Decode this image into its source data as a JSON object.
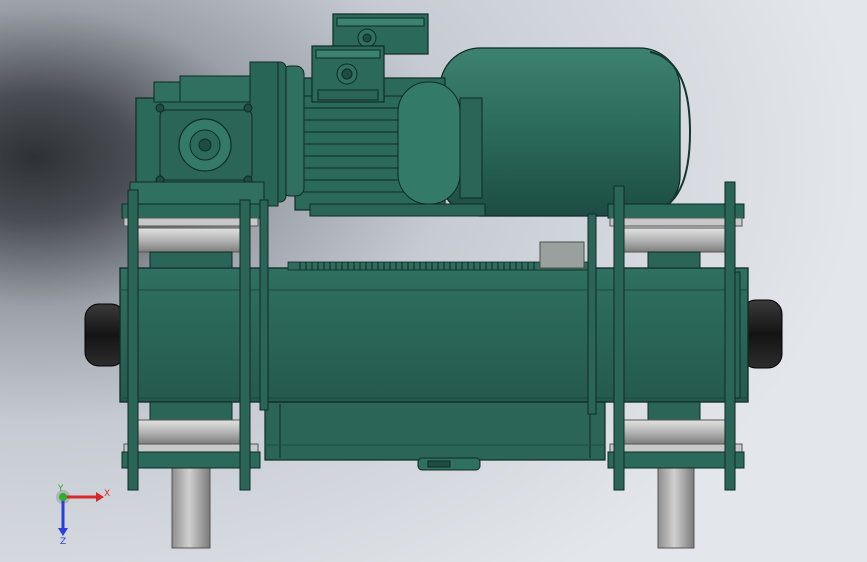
{
  "viewport": {
    "background_colors": [
      "#e6e9ed",
      "#c4c9d1",
      "#8e939b",
      "#3a3d42"
    ],
    "model_colors": {
      "green_body": "#2b6a5b",
      "green_dark": "#1d4d42",
      "green_light": "#3d8270",
      "steel": "#a9a9a9",
      "steel_light": "#d8d8d8",
      "rubber": "#1e1e1e",
      "edge": "#0f2a24"
    }
  },
  "triad": {
    "x_label": "X",
    "y_label": "Y",
    "z_label": "Z",
    "x_color": "#d62a2a",
    "y_color": "#2bb02b",
    "z_color": "#2a3fd6"
  }
}
